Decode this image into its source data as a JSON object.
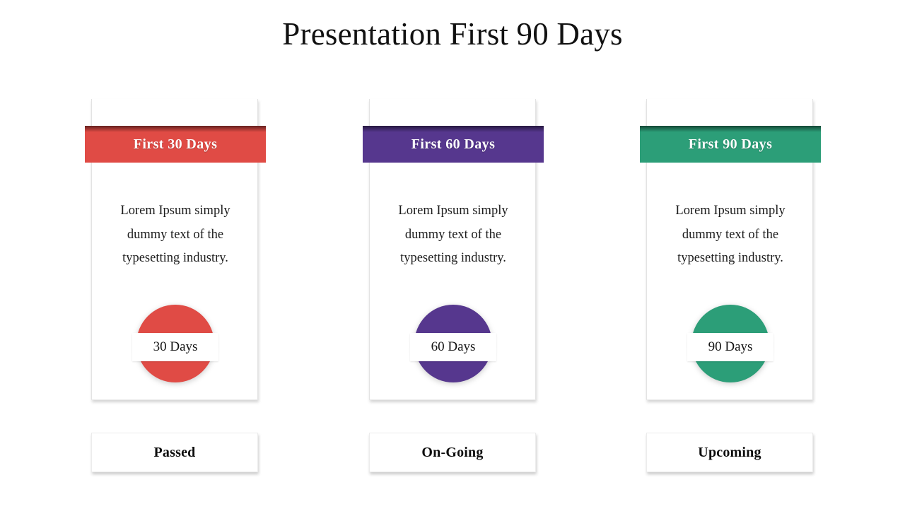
{
  "slide": {
    "title": "Presentation First 90 Days",
    "background_color": "#ffffff"
  },
  "columns": [
    {
      "banner_label": "First 30 Days",
      "body_text": "Lorem Ipsum simply dummy text of the typesetting industry.",
      "badge_label": "30 Days",
      "status_label": "Passed",
      "accent_color": "#e04b45"
    },
    {
      "banner_label": "First 60 Days",
      "body_text": "Lorem Ipsum simply dummy text of the typesetting industry.",
      "badge_label": "60 Days",
      "status_label": "On-Going",
      "accent_color": "#56378e"
    },
    {
      "banner_label": "First 90 Days",
      "body_text": "Lorem Ipsum simply dummy text of the typesetting industry.",
      "badge_label": "90 Days",
      "status_label": "Upcoming",
      "accent_color": "#2c9e78"
    }
  ]
}
